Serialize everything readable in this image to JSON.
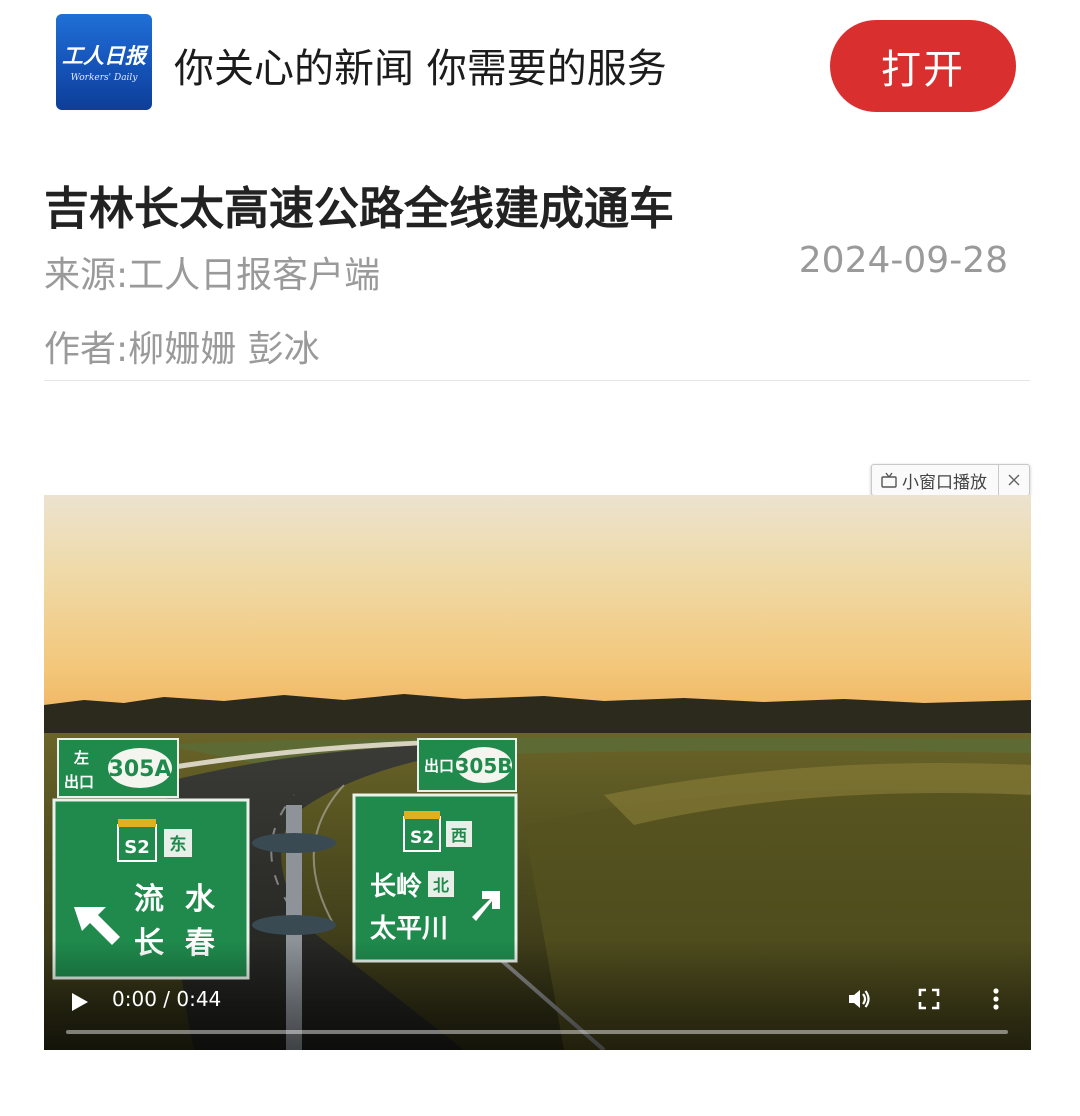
{
  "banner": {
    "logo_text": "工人日报",
    "logo_sub": "Workers' Daily",
    "tagline": "你关心的新闻 你需要的服务",
    "open_label": "打开",
    "open_color": "#d9302f"
  },
  "article": {
    "title": "吉林长太高速公路全线建成通车",
    "source": "来源:工人日报客户端",
    "date": "2024-09-28",
    "author": "作者:柳姗姗 彭冰"
  },
  "pip": {
    "label": "小窗口播放",
    "icon": "tv-icon",
    "close_icon": "close-icon"
  },
  "video": {
    "time": "0:00 / 0:44",
    "progress": 0,
    "icons": [
      "play-icon",
      "volume-icon",
      "fullscreen-icon",
      "more-vert-icon"
    ],
    "signs": {
      "left_top_line1": "左",
      "left_top_line2": "出口",
      "left_exit_number": "305A",
      "left_route": "S2",
      "left_direction": "东",
      "left_dest1": "流  水",
      "left_dest2": "长  春",
      "right_top": "出口",
      "right_exit_number": "305B",
      "right_route": "S2",
      "right_direction": "西",
      "right_dest1": "长岭",
      "right_dest1_suffix": "北",
      "right_dest2": "太平川"
    }
  }
}
